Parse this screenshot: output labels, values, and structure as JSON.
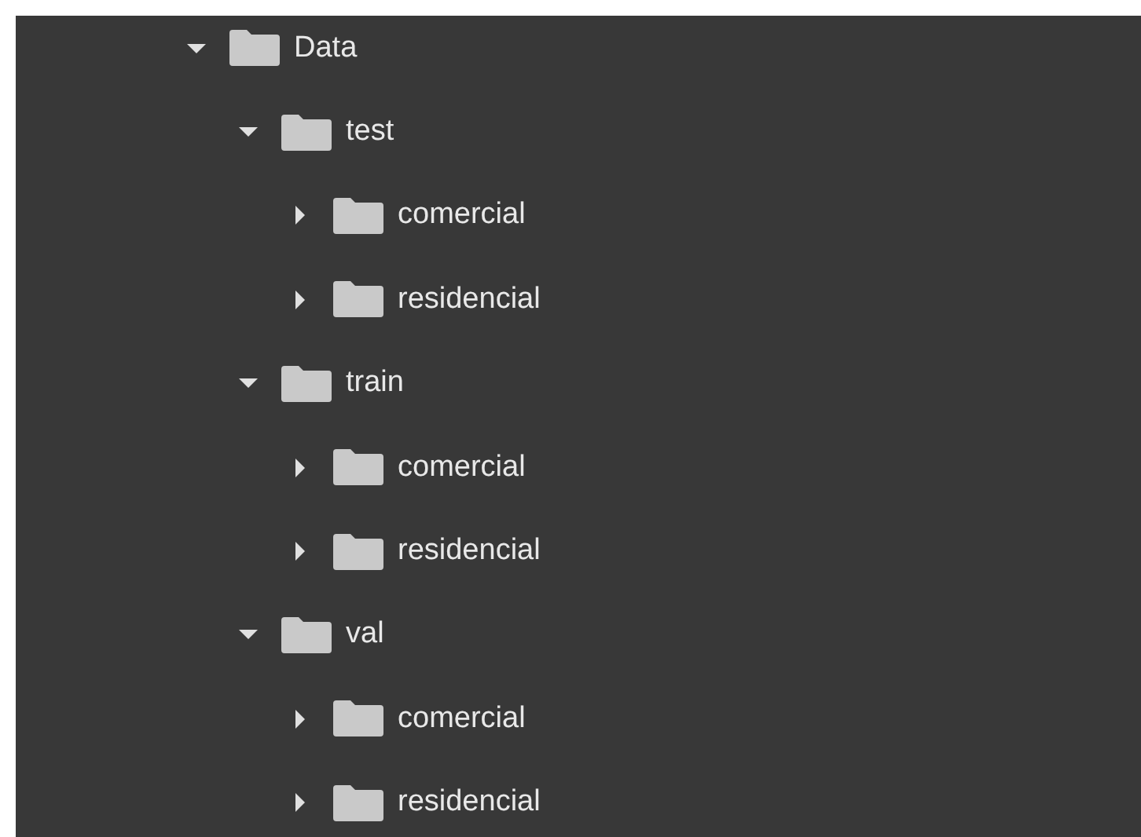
{
  "tree": [
    {
      "name": "Data",
      "expanded": true,
      "children": [
        {
          "name": "test",
          "expanded": true,
          "children": [
            {
              "name": "comercial",
              "expanded": false
            },
            {
              "name": "residencial",
              "expanded": false
            }
          ]
        },
        {
          "name": "train",
          "expanded": true,
          "children": [
            {
              "name": "comercial",
              "expanded": false
            },
            {
              "name": "residencial",
              "expanded": false
            }
          ]
        },
        {
          "name": "val",
          "expanded": true,
          "children": [
            {
              "name": "comercial",
              "expanded": false
            },
            {
              "name": "residencial",
              "expanded": false
            }
          ]
        }
      ]
    }
  ]
}
